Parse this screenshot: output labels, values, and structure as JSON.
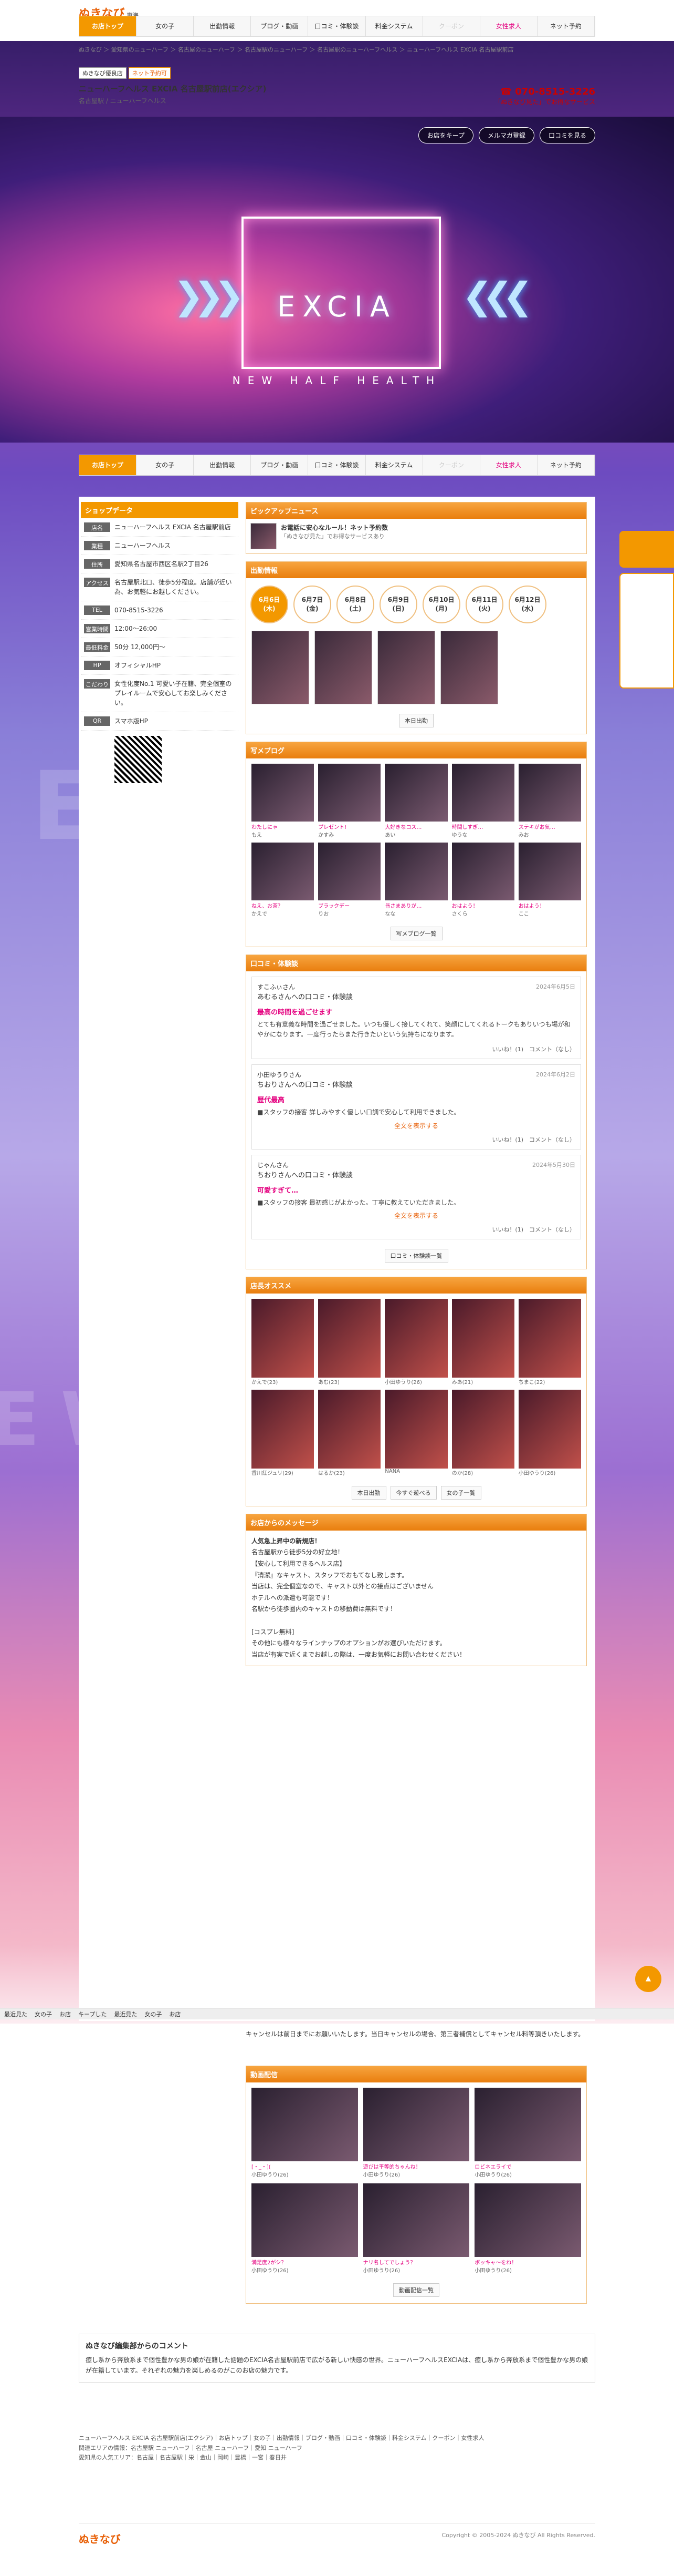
{
  "header": {
    "logo": "ぬきなび",
    "region": "東海",
    "nav": [
      "お店トップ",
      "女の子",
      "出勤情報",
      "ブログ・動画",
      "口コミ・体験談",
      "料金システム",
      "クーポン",
      "女性求人",
      "ネット予約"
    ]
  },
  "breadcrumb": "ぬきなび ＞ 愛知県のニューハーフ ＞ 名古屋のニューハーフ ＞ 名古屋駅のニューハーフ ＞ 名古屋駅のニューハーフヘルス ＞ ニューハーフヘルス EXCIA 名古屋駅前店",
  "shop": {
    "tags": [
      "ぬきなび優良店",
      "ネット予約可"
    ],
    "name": "ニューハーフヘルス EXCIA 名古屋駅前店(エクシア)",
    "sub": "名古屋駅 / ニューハーフヘルス",
    "tel": "070-8515-3226",
    "tel_note": "「ぬきなび見た」でお得なサービス"
  },
  "hero": {
    "buttons": [
      "お店をキープ",
      "メルマガ登録",
      "口コミを見る"
    ],
    "title": "EXCIA",
    "subtitle": "NEW HALF HEALTH"
  },
  "sidebar": {
    "title": "ショップデータ",
    "rows": [
      {
        "k": "店名",
        "v": "ニューハーフヘルス EXCIA 名古屋駅前店"
      },
      {
        "k": "業種",
        "v": "ニューハーフヘルス"
      },
      {
        "k": "住所",
        "v": "愛知県名古屋市西区名駅2丁目26"
      },
      {
        "k": "アクセス",
        "v": "名古屋駅北口、徒歩5分程度。店舗が近い為、お気軽にお越しください。"
      },
      {
        "k": "TEL",
        "v": "070-8515-3226"
      },
      {
        "k": "営業時間",
        "v": "12:00〜26:00"
      },
      {
        "k": "最低料金",
        "v": "50分 12,000円〜"
      },
      {
        "k": "HP",
        "v": "オフィシャルHP"
      },
      {
        "k": "こだわり",
        "v": "女性化度No.1 可愛い子在籍、完全個室のプレイルームで安心してお楽しみください。"
      },
      {
        "k": "QR",
        "v": "スマホ版HP"
      }
    ]
  },
  "pickup": {
    "title": "ピックアップニュース",
    "text": "お電話に安心なルール！ネット予約数",
    "sub": "「ぬきなび見た」でお得なサービスあり"
  },
  "schedule": {
    "title": "出勤情報",
    "days": [
      "6月6日",
      "6月7日",
      "6月8日",
      "6月9日",
      "6月10日",
      "6月11日",
      "6月12日"
    ],
    "weekdays": [
      "(木)",
      "(金)",
      "(土)",
      "(日)",
      "(月)",
      "(火)",
      "(水)"
    ],
    "button": "本日出勤"
  },
  "blog": {
    "title": "写メブログ",
    "captions": [
      "わたしにゃ",
      "プレゼント!",
      "大好きなコス…",
      "時間しすぎ…",
      "ステキがお気…",
      "ねえ、お茶？",
      "ブラックデー",
      "皆さまありが…",
      "おはよう！",
      "おはよう！"
    ],
    "names": [
      "もえ",
      "かすみ",
      "あい",
      "ゆうな",
      "みお",
      "かえで",
      "りお",
      "なな",
      "さくら",
      "ここ"
    ],
    "button": "写メブログ一覧"
  },
  "reviews": {
    "title": "口コミ・体験談",
    "items": [
      {
        "user": "すこふぃさん",
        "shop": "あむるさんへの口コミ・体験談",
        "date": "2024年6月5日",
        "title": "最高の時間を過ごせます",
        "text": "とても有意義な時間を過ごせました。いつも優しく接してくれて、笑顔にしてくれるトークもありいつも場が和やかになります。一度行ったらまた行きたいという気持ちになります。",
        "ok": "いいね！(1)",
        "comment": "コメント（なし）"
      },
      {
        "user": "小田ゆうりさん",
        "shop": "ちおりさんへの口コミ・体験談",
        "date": "2024年6月2日",
        "title": "歴代最高",
        "text": "■スタッフの接客 詳しみやすく優しい口調で安心して利用できました。",
        "ok": "いいね！(1)",
        "comment": "コメント（なし）"
      },
      {
        "user": "じゃんさん",
        "shop": "ちおりさんへの口コミ・体験談",
        "date": "2024年5月30日",
        "title": "可愛すぎて…",
        "text": "■スタッフの接客 最初感じがよかった。丁寧に教えていただきました。",
        "ok": "いいね！(1)",
        "comment": "コメント（なし）"
      }
    ],
    "more": "全文を表示する",
    "button": "口コミ・体験談一覧"
  },
  "recommend": {
    "title": "店長オススメ",
    "names": [
      "かえで(23)",
      "あむ(23)",
      "小田ゆうり(26)",
      "みあ(21)",
      "ちまこ(22)",
      "香川紅ジュリ(29)",
      "はるか(23)",
      "NANA",
      "のか(28)",
      "小田ゆうり(26)"
    ],
    "buttons": [
      "本日出勤",
      "今すぐ遊べる",
      "女の子一覧"
    ]
  },
  "message": {
    "title": "お店からのメッセージ",
    "lines": [
      "人気急上昇中の新規店！",
      "名古屋駅から徒歩5分の好立地！",
      "【安心して利用できるヘルス店】",
      "『清潔』なキャスト、スタッフでおもてなし致します。",
      "当店は、完全個室なので、キャスト以外との接点はございません",
      "ホテルへの派遣も可能です！",
      "名駅から徒歩圏内のキャストの移動費は無料です！"
    ],
    "extra": [
      "[コスプレ無料]",
      "その他にも様々なラインナップのオプションがお選びいただけます。",
      "当店が有実で近くまでお越しの際は、一度お気軽にお問い合わせください！"
    ],
    "cancel": "キャンセルは前日までにお願いいたします。当日キャンセルの場合、第三者補償としてキャンセル料等頂きいたします。"
  },
  "anime": {
    "title": "動画配信",
    "captions": [
      "[・_・](",
      "遊びは平等的ちゃんね！",
      "ロビネエライで",
      "満足度2がシ？",
      "ナリ名してでしょう？",
      "ボッキャ〜をね！"
    ],
    "names": [
      "小田ゆうり(26)",
      "小田ゆうり(26)",
      "小田ゆうり(26)",
      "小田ゆうり(26)",
      "小田ゆうり(26)",
      "小田ゆうり(26)"
    ],
    "button": "動画配信一覧"
  },
  "editor": {
    "title": "ぬきなび編集部からのコメント",
    "text": "癒し系から奔放系まで個性豊かな男の娘が在籍した話題のEXCIA名古屋駅前店で広がる新しい快感の世界。ニューハーフヘルスEXCIAは、癒し系から奔放系まで個性豊かな男の娘が在籍しています。それぞれの魅力を楽しめるのがこのお店の魅力です。"
  },
  "footer": {
    "breadcrumb": "ニューハーフヘルス EXCIA 名古屋駅前店(エクシア)｜お店トップ｜女の子｜出勤情報｜ブログ・動画｜口コミ・体験談｜料金システム｜クーポン｜女性求人",
    "related": "関連エリアの情報：名古屋駅 ニューハーフ｜名古屋 ニューハーフ｜愛知 ニューハーフ",
    "links": "愛知県の人気エリア：名古屋｜名古屋駅｜栄｜金山｜岡崎｜豊橋｜一宮｜春日井",
    "copy": "Copyright © 2005-2024 ぬきなび All Rights Reserved."
  },
  "bottombar": [
    "最近見た",
    "女の子",
    "お店",
    "キープした",
    "最近見た",
    "女の子",
    "お店"
  ]
}
